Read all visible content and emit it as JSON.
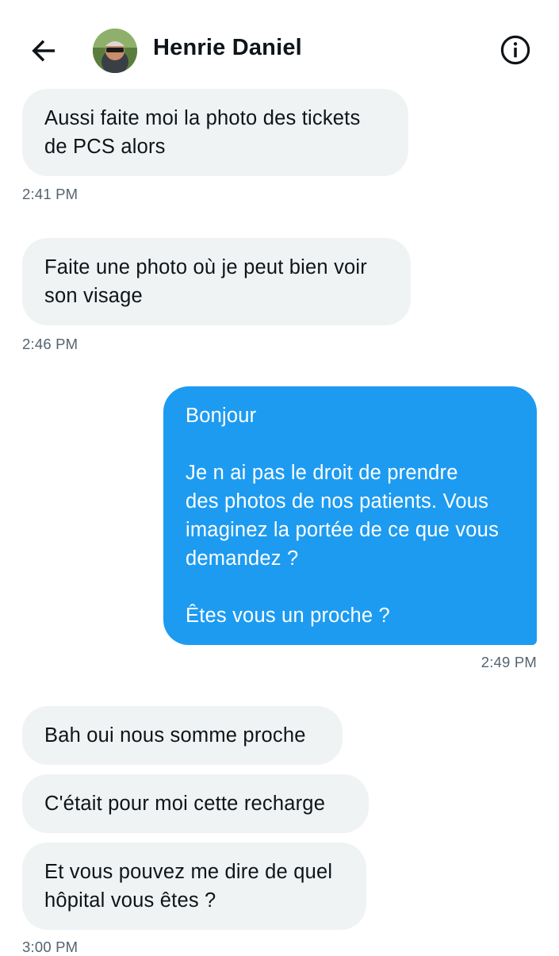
{
  "header": {
    "contact_name": "Henrie Daniel",
    "back_icon": "arrow-left-icon",
    "info_icon": "info-icon"
  },
  "colors": {
    "incoming_bubble": "#eff3f4",
    "outgoing_bubble": "#1d9bf0",
    "timestamp": "#536471"
  },
  "messages": [
    {
      "direction": "incoming",
      "lines": [
        "Aussi faite moi la photo des tickets",
        "de PCS alors"
      ],
      "time": "2:41 PM"
    },
    {
      "direction": "incoming",
      "lines": [
        "Faite une photo où je peut bien voir",
        "son visage"
      ],
      "time": "2:46 PM"
    },
    {
      "direction": "outgoing",
      "lines": [
        "Bonjour",
        "",
        "Je n ai pas le droit de prendre",
        "des photos de nos patients. Vous",
        "imaginez la portée de ce que vous",
        "demandez ?",
        "",
        "Êtes vous un proche ?"
      ],
      "time": "2:49 PM"
    },
    {
      "direction": "incoming",
      "lines": [
        "Bah oui nous somme proche"
      ]
    },
    {
      "direction": "incoming",
      "lines": [
        "C'était pour moi cette recharge"
      ]
    },
    {
      "direction": "incoming",
      "lines": [
        "Et vous pouvez me dire de quel",
        "hôpital vous êtes ?"
      ],
      "time": "3:00 PM"
    }
  ]
}
